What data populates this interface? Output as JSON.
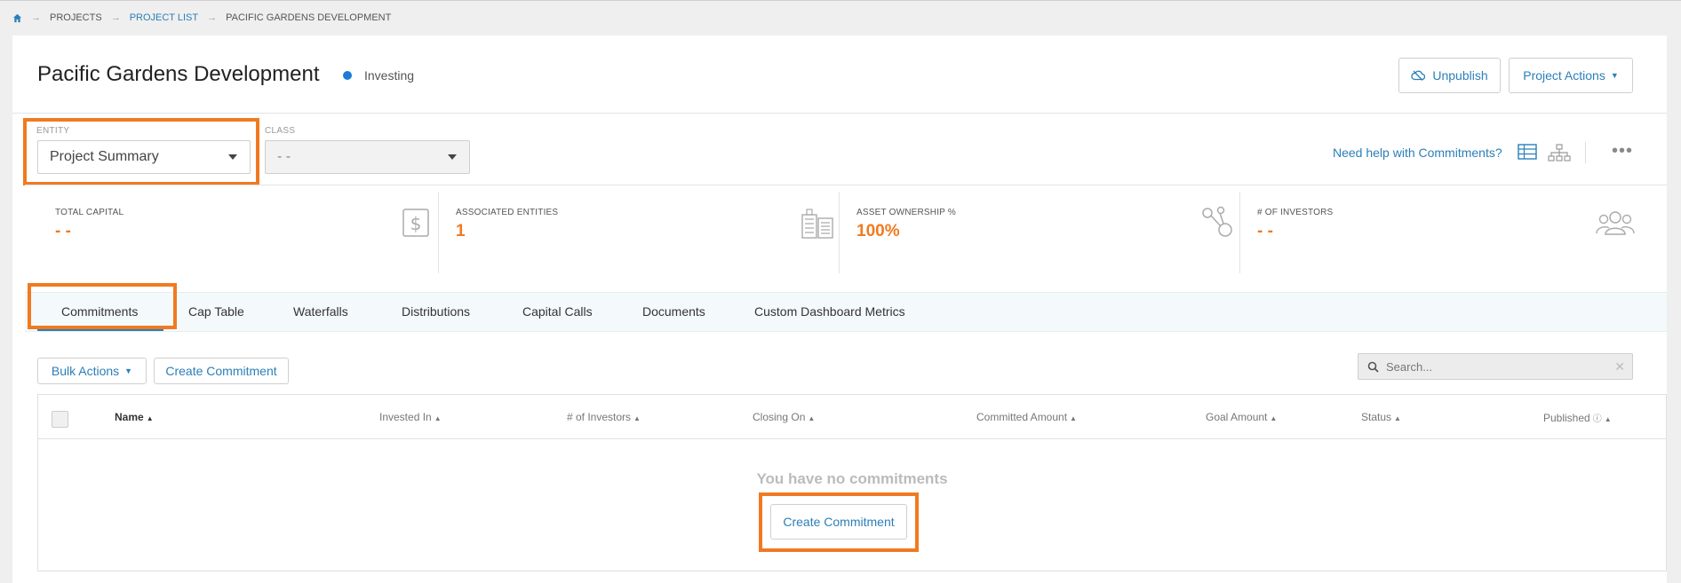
{
  "breadcrumb": {
    "items": [
      "PROJECTS",
      "PROJECT LIST",
      "PACIFIC GARDENS DEVELOPMENT"
    ]
  },
  "header": {
    "title": "Pacific Gardens Development",
    "status": "Investing",
    "status_color": "#1d7bd6",
    "unpublish_label": "Unpublish",
    "project_actions_label": "Project Actions"
  },
  "filters": {
    "entity_label": "ENTITY",
    "entity_value": "Project Summary",
    "class_label": "CLASS",
    "class_value": "- -"
  },
  "help_link": "Need help with Commitments?",
  "stats": [
    {
      "label": "TOTAL CAPITAL",
      "value": "- -",
      "icon": "dollar-icon"
    },
    {
      "label": "ASSOCIATED ENTITIES",
      "value": "1",
      "icon": "buildings-icon"
    },
    {
      "label": "ASSET OWNERSHIP %",
      "value": "100%",
      "icon": "share-nodes-icon"
    },
    {
      "label": "# OF INVESTORS",
      "value": "- -",
      "icon": "users-icon"
    }
  ],
  "tabs": [
    "Commitments",
    "Cap Table",
    "Waterfalls",
    "Distributions",
    "Capital Calls",
    "Documents",
    "Custom Dashboard Metrics"
  ],
  "toolbar": {
    "bulk_actions_label": "Bulk Actions",
    "create_commitment_label": "Create Commitment",
    "search_placeholder": "Search..."
  },
  "table": {
    "columns": [
      "Name",
      "Invested In",
      "# of Investors",
      "Closing On",
      "Committed Amount",
      "Goal Amount",
      "Status",
      "Published"
    ],
    "empty_message": "You have no commitments",
    "empty_button_label": "Create Commitment"
  },
  "colors": {
    "accent": "#2b7fb8",
    "highlight": "#f07a21",
    "stat_value": "#f07a21"
  }
}
